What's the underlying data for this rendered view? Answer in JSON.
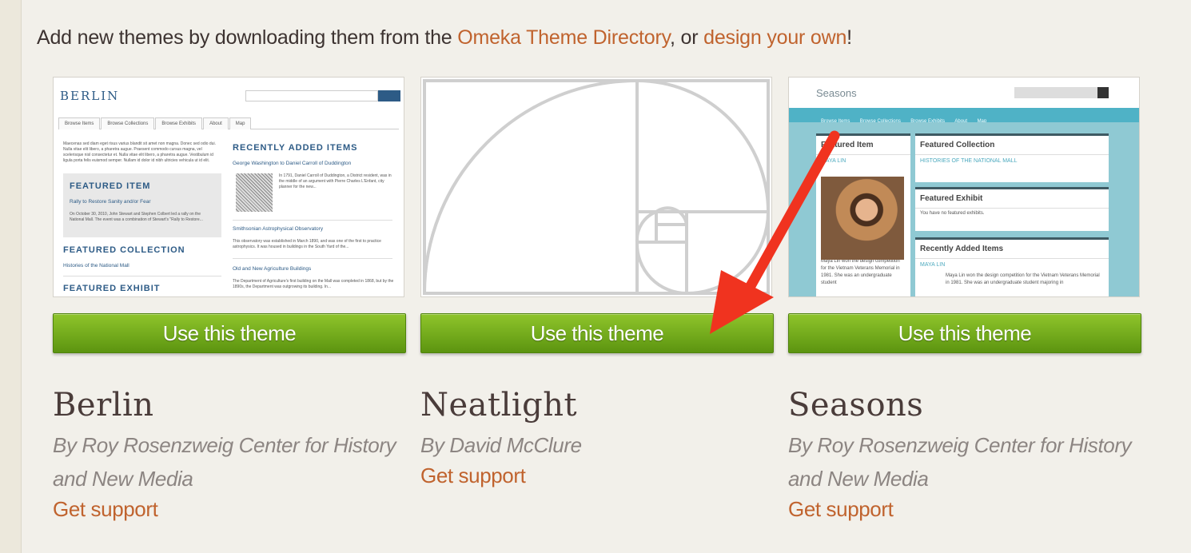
{
  "intro": {
    "prefix": "Add new themes by downloading them from the ",
    "directory_link": "Omeka Theme Directory",
    "middle": ", or ",
    "design_link": "design your own",
    "suffix": "!"
  },
  "themes": [
    {
      "name": "Berlin",
      "author_line1": "By Roy Rosenzweig Center for History",
      "author_line2": "and New Media",
      "button": "Use this theme",
      "support": "Get support",
      "preview": {
        "site_title": "BERLIN",
        "nav": [
          "Browse Items",
          "Browse Collections",
          "Browse Exhibits",
          "About",
          "Map"
        ],
        "intro_text": "Maecenas sed diam eget risus varius blandit sit amet non magna. Donec sed odio dui. Nulla vitae elit libero, a pharetra augue. Praesent commodo cursus magna, vel scelerisque nisl consectetur et. Nulla vitae elit libero, a pharetra augue. Vestibulum id ligula porta felis euismod semper. Nullam id dolor id nibh ultricies vehicula ut id elit.",
        "featured_item_heading": "FEATURED ITEM",
        "featured_item_link": "Rally to Restore Sanity and/or Fear",
        "featured_item_text": "On October 30, 2010, John Stewart and Stephen Colbert led a rally on the National Mall. The event was a combination of Stewart's \"Rally to Restore...",
        "featured_collection_heading": "FEATURED COLLECTION",
        "featured_collection_link": "Histories of the National Mall",
        "featured_exhibit_heading": "FEATURED EXHIBIT",
        "recent_heading": "RECENTLY ADDED ITEMS",
        "recent_items": [
          {
            "title": "George Washington to Daniel Carroll of Duddington",
            "text": "In 1791, Daniel Carroll of Duddington, a District resident, was in the middle of an argument with Pierre Charles L'Enfant, city planner for the new..."
          },
          {
            "title": "Smithsonian Astrophysical Observatory",
            "text": "This observatory was established in March 1890, and was one of the first to practice astrophysics. It was housed in buildings in the South Yard of the..."
          },
          {
            "title": "Old and New Agriculture Buildings",
            "text": "The Department of Agriculture's first building on the Mall was completed in 1868, but by the 1890s, the Department was outgrowing its building. In..."
          }
        ]
      }
    },
    {
      "name": "Neatlight",
      "author_line1": "By David McClure",
      "author_line2": "",
      "button": "Use this theme",
      "support": "Get support"
    },
    {
      "name": "Seasons",
      "author_line1": "By Roy Rosenzweig Center for History",
      "author_line2": "and New Media",
      "button": "Use this theme",
      "support": "Get support",
      "preview": {
        "site_title": "Seasons",
        "nav": [
          "Browse Items",
          "Browse Collections",
          "Browse Exhibits",
          "About",
          "Map"
        ],
        "featured_item_heading": "Featured Item",
        "featured_item_link": "MAYA LIN",
        "featured_item_text": "Maya Lin won the design competition for the Vietnam Veterans Memorial in 1981. She was an undergraduate student",
        "featured_collection_heading": "Featured Collection",
        "featured_collection_link": "HISTORIES OF THE NATIONAL MALL",
        "featured_exhibit_heading": "Featured Exhibit",
        "featured_exhibit_text": "You have no featured exhibits.",
        "recent_heading": "Recently Added Items",
        "recent_link": "MAYA LIN",
        "recent_text": "Maya Lin won the design competition for the Vietnam Veterans Memorial in 1981. She was an undergraduate student majoring in"
      }
    }
  ],
  "colors": {
    "link": "#c0632e",
    "button": "#7ab51d",
    "arrow": "#f0331f",
    "background": "#f2f0ea"
  }
}
